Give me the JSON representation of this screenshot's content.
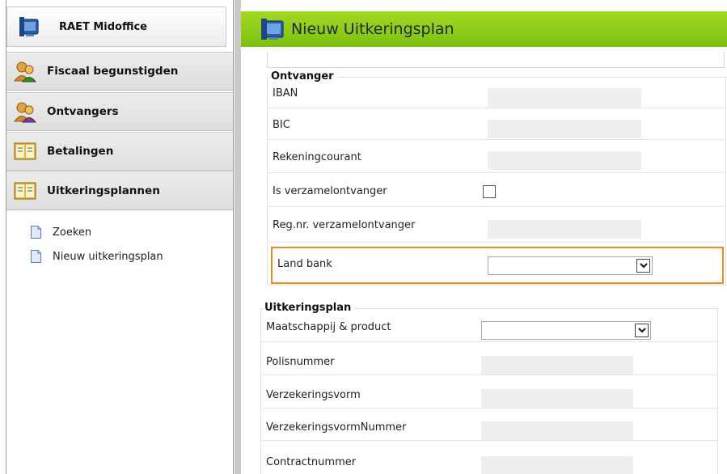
{
  "sidebar": {
    "brand": {
      "label": "RAET Midoffice",
      "icon": "monitor-icon"
    },
    "nav": [
      {
        "label": "Fiscaal begunstigden",
        "icon": "users-icon"
      },
      {
        "label": "Ontvangers",
        "icon": "users-icon"
      },
      {
        "label": "Betalingen",
        "icon": "book-icon"
      },
      {
        "label": "Uitkeringsplannen",
        "icon": "book-icon"
      }
    ],
    "sub_items": [
      {
        "label": "Zoeken",
        "icon": "document-icon"
      },
      {
        "label": "Nieuw uitkeringsplan",
        "icon": "document-icon"
      }
    ]
  },
  "page": {
    "title": "Nieuw Uitkeringsplan",
    "title_icon": "monitor-icon",
    "accent_color": "#8cc618",
    "highlight_color": "#f08a1c"
  },
  "ontvanger": {
    "legend": "Ontvanger",
    "iban_label": "IBAN",
    "iban_value": "",
    "bic_label": "BIC",
    "bic_value": "",
    "rekeningcourant_label": "Rekeningcourant",
    "rekeningcourant_value": "",
    "is_verzamelontvanger_label": "Is verzamelontvanger",
    "is_verzamelontvanger_checked": false,
    "reg_nr_label": "Reg.nr. verzamelontvanger",
    "reg_nr_value": "",
    "land_bank_label": "Land bank",
    "land_bank_value": ""
  },
  "uitkeringsplan": {
    "legend": "Uitkeringsplan",
    "maatschappij_label": "Maatschappij & product",
    "maatschappij_value": "",
    "polisnummer_label": "Polisnummer",
    "polisnummer_value": "",
    "verzekeringsvorm_label": "Verzekeringsvorm",
    "verzekeringsvorm_value": "",
    "verzekeringsvormnummer_label": "VerzekeringsvormNummer",
    "verzekeringsvormnummer_value": "",
    "contractnummer_label": "Contractnummer",
    "contractnummer_value": ""
  }
}
